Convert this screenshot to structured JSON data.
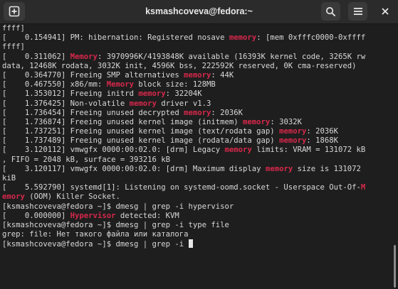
{
  "window": {
    "title": "ksmashcoveva@fedora:~"
  },
  "icons": {
    "new_tab": "new-tab-plus-icon",
    "search": "search-icon",
    "menu": "hamburger-menu-icon",
    "close": "close-icon"
  },
  "colors": {
    "highlight": "#d6284b",
    "text": "#d8d8d8",
    "background": "#1e1e1e",
    "titlebar": "#2b2b2b"
  },
  "terminal": {
    "lines": [
      [
        {
          "t": "ffff]"
        }
      ],
      [
        {
          "t": "[    0.154941] PM: hibernation: Registered nosave "
        },
        {
          "t": "memory",
          "hl": true
        },
        {
          "t": ": [mem 0xfffc0000-0xffff"
        }
      ],
      [
        {
          "t": "ffff]"
        }
      ],
      [
        {
          "t": "[    0.311062] "
        },
        {
          "t": "Memory",
          "hl": true
        },
        {
          "t": ": 3970996K/4193848K available (16393K kernel code, 3265K rw"
        }
      ],
      [
        {
          "t": "data, 12468K rodata, 3032K init, 4596K bss, 222592K reserved, 0K cma-reserved)"
        }
      ],
      [
        {
          "t": "[    0.364770] Freeing SMP alternatives "
        },
        {
          "t": "memory",
          "hl": true
        },
        {
          "t": ": 44K"
        }
      ],
      [
        {
          "t": "[    0.467550] x86/mm: "
        },
        {
          "t": "Memory",
          "hl": true
        },
        {
          "t": " block size: 128MB"
        }
      ],
      [
        {
          "t": "[    1.353012] Freeing initrd "
        },
        {
          "t": "memory",
          "hl": true
        },
        {
          "t": ": 32204K"
        }
      ],
      [
        {
          "t": "[    1.376425] Non-volatile "
        },
        {
          "t": "memory",
          "hl": true
        },
        {
          "t": " driver v1.3"
        }
      ],
      [
        {
          "t": "[    1.736454] Freeing unused decrypted "
        },
        {
          "t": "memory",
          "hl": true
        },
        {
          "t": ": 2036K"
        }
      ],
      [
        {
          "t": "[    1.736874] Freeing unused kernel image (initmem) "
        },
        {
          "t": "memory",
          "hl": true
        },
        {
          "t": ": 3032K"
        }
      ],
      [
        {
          "t": "[    1.737251] Freeing unused kernel image (text/rodata gap) "
        },
        {
          "t": "memory",
          "hl": true
        },
        {
          "t": ": 2036K"
        }
      ],
      [
        {
          "t": "[    1.737489] Freeing unused kernel image (rodata/data gap) "
        },
        {
          "t": "memory",
          "hl": true
        },
        {
          "t": ": 1868K"
        }
      ],
      [
        {
          "t": "[    3.120112] vmwgfx 0000:00:02.0: [drm] Legacy "
        },
        {
          "t": "memory",
          "hl": true
        },
        {
          "t": " limits: VRAM = 131072 kB"
        }
      ],
      [
        {
          "t": ", FIFO = 2048 kB, surface = 393216 kB"
        }
      ],
      [
        {
          "t": "[    3.120117] vmwgfx 0000:00:02.0: [drm] Maximum display "
        },
        {
          "t": "memory",
          "hl": true
        },
        {
          "t": " size is 131072"
        }
      ],
      [
        {
          "t": "kiB"
        }
      ],
      [
        {
          "t": "[    5.592790] systemd[1]: Listening on systemd-oomd.socket - Userspace Out-Of-"
        },
        {
          "t": "M",
          "hl": true
        }
      ],
      [
        {
          "t": "emory",
          "hl": true
        },
        {
          "t": " (OOM) Killer Socket."
        }
      ],
      [
        {
          "t": "[ksmashcoveva@fedora ~]$ dmesg | grep -i hypervisor"
        }
      ],
      [
        {
          "t": "[    0.000000] "
        },
        {
          "t": "Hypervisor",
          "hl": true
        },
        {
          "t": " detected: KVM"
        }
      ],
      [
        {
          "t": "[ksmashcoveva@fedora ~]$ dmesg | grep -i type file"
        }
      ],
      [
        {
          "t": "grep: file: Нет такого файла или каталога"
        }
      ],
      [
        {
          "t": "[ksmashcoveva@fedora ~]$ dmesg | grep -i "
        }
      ]
    ]
  }
}
